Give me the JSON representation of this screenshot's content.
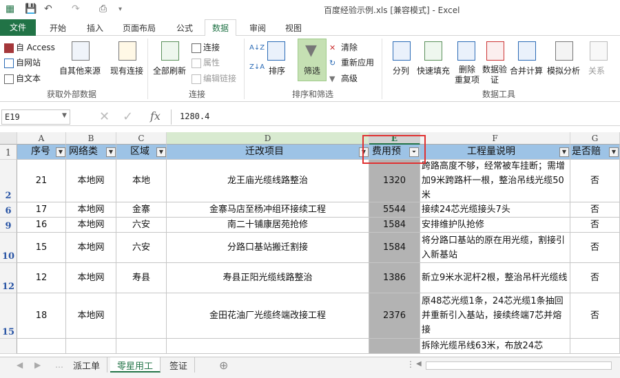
{
  "titlebar": {
    "title": "百度经验示例.xls  [兼容模式] - Excel"
  },
  "tabs": [
    {
      "label": "文件"
    },
    {
      "label": "开始"
    },
    {
      "label": "插入"
    },
    {
      "label": "页面布局"
    },
    {
      "label": "公式"
    },
    {
      "label": "数据"
    },
    {
      "label": "审阅"
    },
    {
      "label": "视图"
    }
  ],
  "ribbon": {
    "get_external": {
      "access": "自 Access",
      "web": "自网站",
      "text": "自文本",
      "other": "自其他来源",
      "existing": "现有连接",
      "label": "获取外部数据"
    },
    "connections": {
      "refresh": "全部刷新",
      "conn": "连接",
      "props": "属性",
      "edit_links": "编辑链接",
      "label": "连接"
    },
    "sortfilter": {
      "sort": "排序",
      "filter": "筛选",
      "clear": "清除",
      "reapply": "重新应用",
      "advanced": "高级",
      "label": "排序和筛选"
    },
    "datatools": {
      "split": "分列",
      "flash": "快速填充",
      "remove_dup": "删除\n重复项",
      "validation": "数据验\n证",
      "consolidate": "合并计算",
      "whatif": "模拟分析",
      "relations": "关系",
      "label": "数据工具"
    }
  },
  "formulabar": {
    "namebox": "E19",
    "value": "1280.4",
    "fx": "fx"
  },
  "columns": [
    "A",
    "B",
    "C",
    "D",
    "E",
    "F",
    "G"
  ],
  "header_row": {
    "num": "1",
    "cells": [
      "序号",
      "网络类",
      "区域",
      "迁改项目",
      "费用预",
      "工程量说明",
      "是否赔"
    ]
  },
  "rows": [
    {
      "num": "2",
      "cells": [
        "21",
        "本地网",
        "本地",
        "龙王庙光缆线路整治",
        "1320",
        "跨路高度不够，经常被车挂断；需增加9米跨路杆一根，整治吊线光缆50米",
        "否"
      ]
    },
    {
      "num": "6",
      "cells": [
        "17",
        "本地网",
        "金寨",
        "金寨马店至杨冲组环接续工程",
        "5544",
        "接续24芯光缆接头7头",
        "否"
      ]
    },
    {
      "num": "9",
      "cells": [
        "16",
        "本地网",
        "六安",
        "南二十铺康居苑抢修",
        "1584",
        "安排维护队抢修",
        "否"
      ]
    },
    {
      "num": "10",
      "cells": [
        "15",
        "本地网",
        "六安",
        "分路口基站搬迁割接",
        "1584",
        "将分路口基站的原在用光缆，割接引入新基站",
        "否"
      ]
    },
    {
      "num": "12",
      "cells": [
        "12",
        "本地网",
        "寿县",
        "寿县正阳光缆线路整治",
        "1386",
        "新立9米水泥杆2根，整治吊杆光缆线",
        "否"
      ]
    },
    {
      "num": "15",
      "cells": [
        "18",
        "本地网",
        "",
        "金田花油厂光缆终端改接工程",
        "2376",
        "原48芯光缆1条，24芯光缆1条抽回并重新引入基站，接续终端7芯并熔接",
        "否"
      ]
    },
    {
      "num": "",
      "cells": [
        "",
        "",
        "",
        "",
        "",
        "拆除光缆吊线63米，布放24芯",
        "",
        ""
      ]
    }
  ],
  "sheets": [
    "派工单",
    "零星用工",
    "签证"
  ],
  "active_sheet": "零星用工"
}
